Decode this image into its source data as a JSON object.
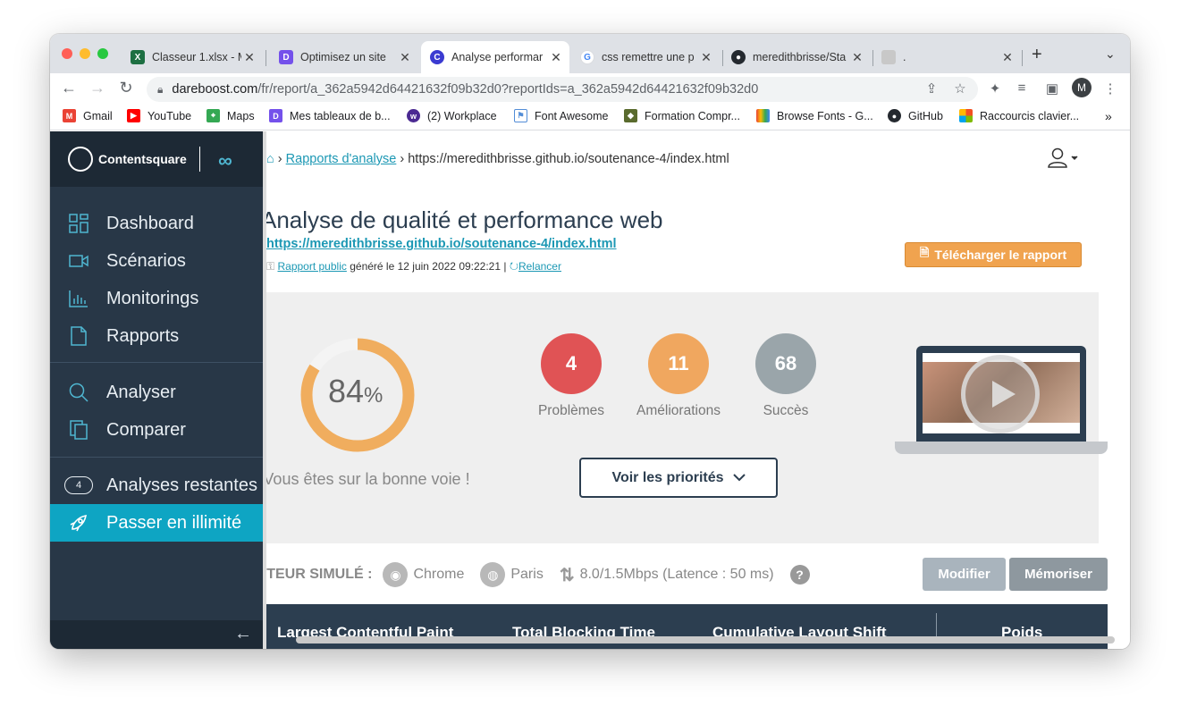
{
  "browser": {
    "tabs": [
      {
        "title": "Classeur 1.xlsx - M",
        "icon": "excel-icon",
        "color": "#1d6f42"
      },
      {
        "title": "Optimisez un site",
        "icon": "openclassrooms-icon",
        "color": "#7451eb"
      },
      {
        "title": "Analyse performar",
        "icon": "contentsquare-icon",
        "color": "#3b3bd1"
      },
      {
        "title": "css remettre une p",
        "icon": "google-icon",
        "color": "#4285f4"
      },
      {
        "title": "meredithbrisse/Sta",
        "icon": "github-icon",
        "color": "#24292f"
      },
      {
        "title": ".",
        "icon": "generic-page-icon",
        "color": "#9aa0a6"
      }
    ],
    "url_domain": "dareboost.com",
    "url_path": "/fr/report/a_362a5942d64421632f09b32d0?reportIds=a_362a5942d64421632f09b32d0",
    "profile_initial": "M",
    "bookmarks": [
      {
        "label": "Gmail",
        "icon": "gmail-icon",
        "color": "#ea4335"
      },
      {
        "label": "YouTube",
        "icon": "youtube-icon",
        "color": "#ff0000"
      },
      {
        "label": "Maps",
        "icon": "maps-icon",
        "color": "#34a853"
      },
      {
        "label": "Mes tableaux de b...",
        "icon": "openclassrooms-icon",
        "color": "#7451eb"
      },
      {
        "label": "(2) Workplace",
        "icon": "workplace-icon",
        "color": "#4b2a92"
      },
      {
        "label": "Font Awesome",
        "icon": "flag-icon",
        "color": "#528dd7"
      },
      {
        "label": "Formation Compr...",
        "icon": "formation-icon",
        "color": "#5a6b2e"
      },
      {
        "label": "Browse Fonts - G...",
        "icon": "google-fonts-icon",
        "color": "#ea4335"
      },
      {
        "label": "GitHub",
        "icon": "github-icon",
        "color": "#24292f"
      },
      {
        "label": "Raccourcis clavier...",
        "icon": "microsoft-icon",
        "color": "#f25022"
      }
    ]
  },
  "sidebar": {
    "brand": "Contentsquare",
    "items": [
      {
        "label": "Dashboard",
        "icon": "dashboard-icon"
      },
      {
        "label": "Scénarios",
        "icon": "video-icon"
      },
      {
        "label": "Monitorings",
        "icon": "chart-icon"
      },
      {
        "label": "Rapports",
        "icon": "document-icon"
      },
      {
        "label": "Analyser",
        "icon": "search-icon"
      },
      {
        "label": "Comparer",
        "icon": "copy-icon"
      }
    ],
    "remaining": {
      "count": "4",
      "label": "Analyses restantes"
    },
    "upgrade": {
      "label": "Passer en illimité",
      "icon": "rocket-icon"
    }
  },
  "breadcrumb": {
    "link": "Rapports d'analyse",
    "current": "https://meredithbrisse.github.io/soutenance-4/index.html"
  },
  "report": {
    "title": "Analyse de qualité et performance web",
    "url": "https://meredithbrisse.github.io/soutenance-4/index.html",
    "public_link": "Rapport public",
    "generated": "généré le 12 juin 2022 09:22:21 |",
    "relaunch": "Relancer",
    "download": "Télécharger le rapport"
  },
  "score": {
    "value": "84",
    "unit": "%",
    "fraction": 0.84,
    "message": "Vous êtes sur la bonne voie !"
  },
  "counts": [
    {
      "value": "4",
      "label": "Problèmes",
      "color": "#e05355"
    },
    {
      "value": "11",
      "label": "Améliorations",
      "color": "#f0a75f"
    },
    {
      "value": "68",
      "label": "Succès",
      "color": "#9aa5aa"
    }
  ],
  "priorities_button": "Voir les priorités",
  "simulation": {
    "label": "VISITEUR SIMULÉ :",
    "browser": "Chrome",
    "location": "Paris",
    "network": "8.0/1.5Mbps (Latence : 50 ms)",
    "modify": "Modifier",
    "save": "Mémoriser"
  },
  "metrics": [
    "Largest Contentful Paint",
    "Total Blocking Time",
    "Cumulative Layout Shift",
    "Poids"
  ],
  "colors": {
    "accent": "#1c98b4",
    "sidebar": "#283747",
    "active": "#0ea5c3",
    "orange": "#f0a34f"
  }
}
